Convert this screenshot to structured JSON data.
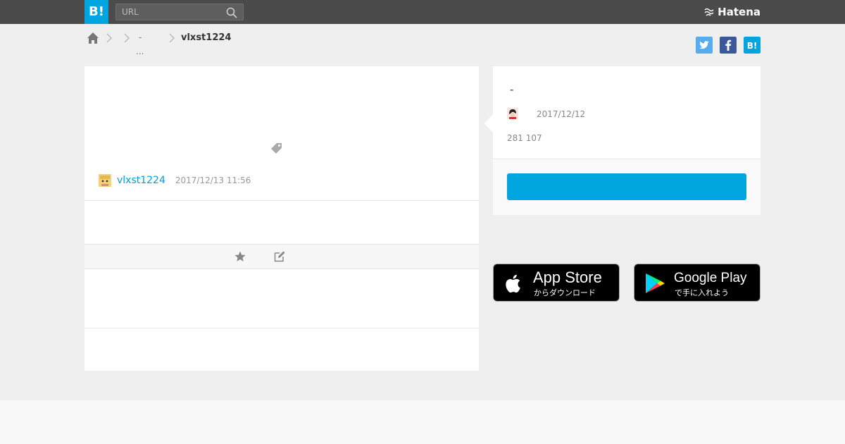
{
  "header": {
    "logo_text": "B!",
    "search": {
      "placeholder": "URL",
      "value": ""
    },
    "brand": "Hatena"
  },
  "breadcrumb": {
    "item_1": "-",
    "item_1_more": "...",
    "current": "vlxst1224"
  },
  "entry": {
    "user": {
      "name": "vlxst1224",
      "timestamp": "2017/12/13 11:56"
    }
  },
  "side": {
    "title": "-",
    "date": "2017/12/12",
    "counts": "281 107",
    "button_label": ""
  },
  "stores": {
    "apple": {
      "main": "App Store",
      "sub": "からダウンロード"
    },
    "google": {
      "main": "Google Play",
      "sub": "で手に入れよう"
    }
  },
  "colors": {
    "accent": "#00a4de",
    "topbar": "#4b4b4b",
    "twitter": "#55acee",
    "facebook": "#3b5998",
    "hatena": "#00a4de",
    "link": "#00a0d8"
  }
}
